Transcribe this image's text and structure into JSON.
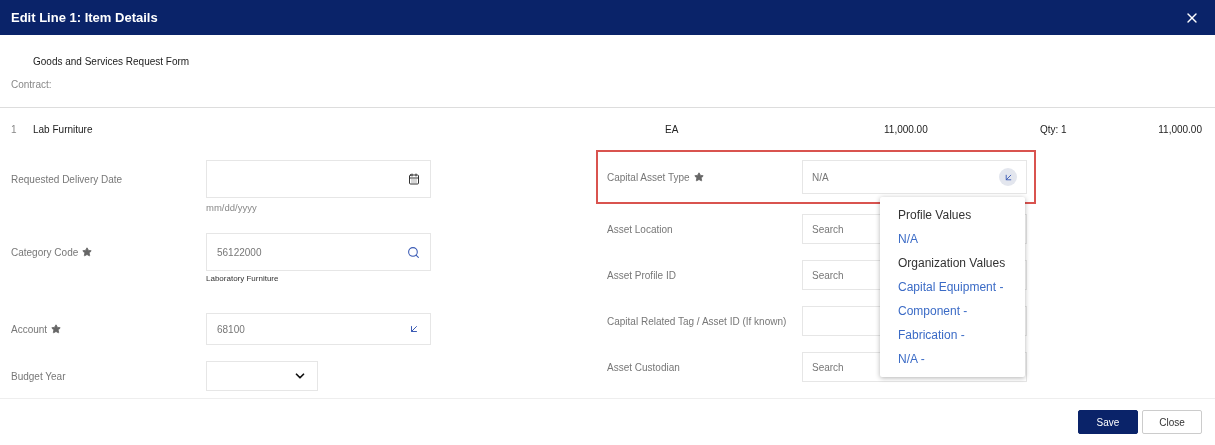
{
  "window": {
    "title": "Edit Line 1: Item Details"
  },
  "header": {
    "form_title": "Goods and Services Request Form",
    "contract_label": "Contract:"
  },
  "line": {
    "number": "1",
    "name": "Lab Furniture",
    "uom": "EA",
    "price": "11,000.00",
    "qty": "Qty: 1",
    "total": "11,000.00"
  },
  "left_fields": [
    {
      "label": "Requested Delivery Date",
      "required": false,
      "kind": "date",
      "hint": "mm/dd/yyyy"
    },
    {
      "label": "Category Code",
      "required": true,
      "kind": "search",
      "value": "56122000",
      "helper": "Laboratory Furniture"
    },
    {
      "label": "Account",
      "required": true,
      "kind": "lookup",
      "value": "68100"
    },
    {
      "label": "Budget Year",
      "required": false,
      "kind": "select"
    }
  ],
  "right_fields": [
    {
      "label": "Capital Asset Type",
      "required": true,
      "kind": "lookup",
      "value": "N/A",
      "highlighted": true
    },
    {
      "label": "Asset Location",
      "required": false,
      "kind": "text",
      "placeholder": "Search",
      "highlighted": false
    },
    {
      "label": "Asset Profile ID",
      "required": false,
      "kind": "text",
      "placeholder": "Search",
      "highlighted": false
    },
    {
      "label": "Capital Related Tag / Asset ID (If known)",
      "required": false,
      "kind": "text",
      "highlighted": false
    },
    {
      "label": "Asset Custodian",
      "required": false,
      "kind": "text",
      "placeholder": "Search",
      "highlighted": false
    }
  ],
  "dropdown": {
    "groups": [
      {
        "heading": "Profile Values",
        "options": [
          "N/A"
        ]
      },
      {
        "heading": "Organization Values",
        "options": [
          "Capital Equipment -",
          "Component -",
          "Fabrication -",
          "N/A -"
        ]
      }
    ]
  },
  "buttons": [
    {
      "label": "Save",
      "primary": true
    },
    {
      "label": "Close",
      "primary": false
    }
  ]
}
